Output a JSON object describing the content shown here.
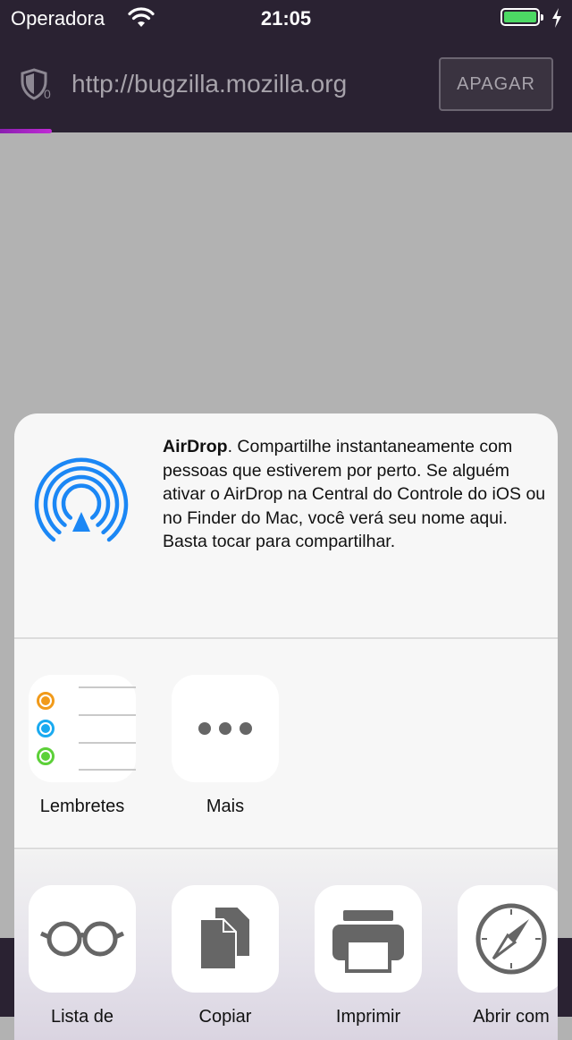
{
  "status_bar": {
    "carrier": "Operadora",
    "time": "21:05",
    "wifi_icon": "wifi-icon",
    "battery_icon": "battery-icon",
    "charging_icon": "charging-icon"
  },
  "browser": {
    "url": "http://bugzilla.mozilla.org",
    "clear_label": "APAGAR",
    "shield_icon": "tracking-protection-shield-icon",
    "shield_count": "0",
    "load_progress": 0.09,
    "progress_color": "#a020c0"
  },
  "share_sheet": {
    "airdrop": {
      "title": "AirDrop",
      "description": ". Compartilhe instantaneamente com pessoas que estiverem por perto. Se alguém ativar o AirDrop na Central do Controle do iOS ou no Finder do Mac, você verá seu nome aqui. Basta tocar para compartilhar.",
      "icon": "airdrop-icon",
      "color": "#1b87f5"
    },
    "apps": [
      {
        "label": "Lembretes",
        "icon": "reminders-icon"
      },
      {
        "label": "Mais",
        "icon": "more-icon"
      }
    ],
    "actions": [
      {
        "label": "Lista de",
        "icon": "reading-list-icon"
      },
      {
        "label": "Copiar",
        "icon": "copy-icon"
      },
      {
        "label": "Imprimir",
        "icon": "print-icon"
      },
      {
        "label": "Abrir com",
        "icon": "compass-icon"
      }
    ]
  },
  "colors": {
    "toolbar": "#2a2232",
    "page_overlay": "#b2b2b2",
    "sheet": "#f7f7f7",
    "reminder_orange": "#f19a1a",
    "reminder_blue": "#1aaaf0",
    "reminder_green": "#5cd038"
  }
}
